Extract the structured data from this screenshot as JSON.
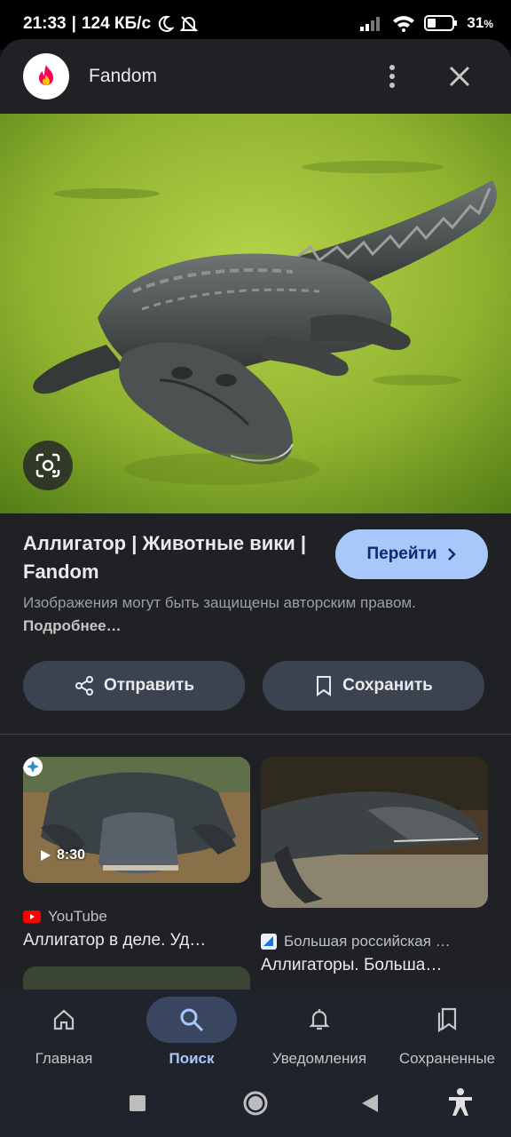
{
  "status_bar": {
    "time": "21:33",
    "network_speed": "124 КБ/с",
    "battery": "31",
    "battery_unit": "%",
    "icons": [
      "moon-icon",
      "bell-off-icon",
      "signal-icon",
      "wifi-icon",
      "battery-icon"
    ]
  },
  "sheet": {
    "site_name": "Fandom",
    "title": "Аллигатор | Животные вики | Fandom",
    "goto_label": "Перейти",
    "copyright_text": "Изображения могут быть защищены авторским правом.",
    "more_label": "Подробнее…",
    "share_label": "Отправить",
    "save_label": "Сохранить"
  },
  "results": [
    {
      "source": "YouTube",
      "title": "Аллигатор в деле. Уд…",
      "duration": "8:30"
    },
    {
      "source": "Большая российская …",
      "title": "Аллигаторы. Большa…"
    }
  ],
  "bottom_nav": [
    {
      "label": "Главная",
      "icon": "home-icon",
      "active": false
    },
    {
      "label": "Поиск",
      "icon": "search-icon",
      "active": true
    },
    {
      "label": "Уведомления",
      "icon": "bell-icon",
      "active": false
    },
    {
      "label": "Сохраненные",
      "icon": "bookmarks-icon",
      "active": false
    }
  ],
  "colors": {
    "accent": "#a8c7fa",
    "sheet_bg": "#202124",
    "button_bg": "#3c4350"
  }
}
